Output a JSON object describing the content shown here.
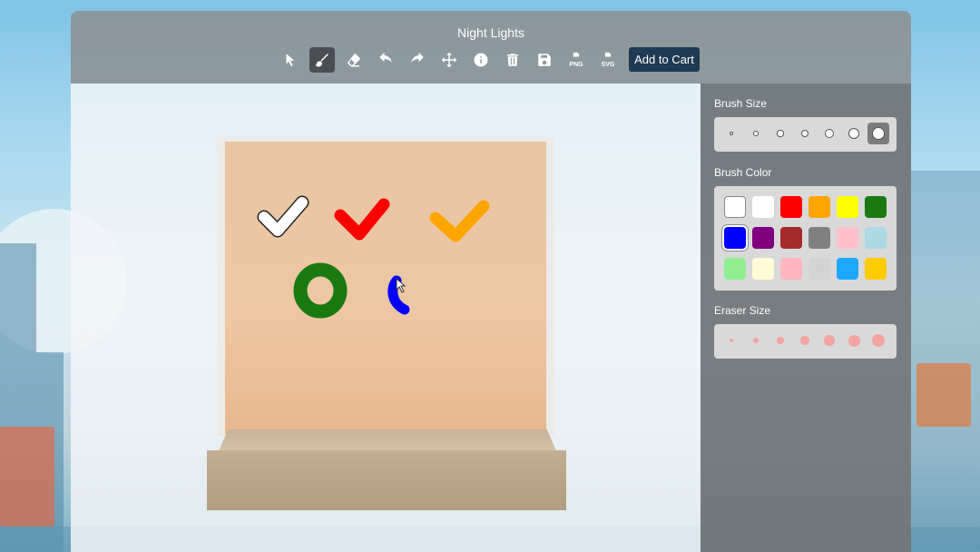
{
  "app": {
    "title": "Night Lights"
  },
  "toolbar": {
    "tools": [
      {
        "name": "select",
        "icon": "cursor-arrow-icon"
      },
      {
        "name": "brush",
        "icon": "paintbrush-icon",
        "active": true
      },
      {
        "name": "eraser",
        "icon": "eraser-icon"
      },
      {
        "name": "undo",
        "icon": "undo-arrow-icon"
      },
      {
        "name": "redo",
        "icon": "redo-arrow-icon"
      },
      {
        "name": "move",
        "icon": "move-arrows-icon"
      },
      {
        "name": "info",
        "icon": "info-circle-icon"
      },
      {
        "name": "delete",
        "icon": "trash-icon"
      },
      {
        "name": "save",
        "icon": "save-disk-icon"
      },
      {
        "name": "export-png",
        "icon": "png-file-icon",
        "label": "PNG"
      },
      {
        "name": "export-svg",
        "icon": "svg-file-icon",
        "label": "SVG"
      }
    ],
    "cart_label": "Add to Cart"
  },
  "panel": {
    "brush_size_title": "Brush Size",
    "brush_sizes_count": 7,
    "brush_size_selected_index": 6,
    "brush_color_title": "Brush Color",
    "colors": [
      "#ffffff",
      "#ffffff",
      "#ff0000",
      "#ffa500",
      "#ffff00",
      "#1a7a12",
      "#0000ff",
      "#800080",
      "#a52a2a",
      "#808080",
      "#ffc0cb",
      "#add8e6",
      "#90ee90",
      "#fffbd6",
      "#ffb6c1",
      "#d3d3d3",
      "#1ea7ff",
      "#ffcc00"
    ],
    "color_selected_index": 6,
    "eraser_size_title": "Eraser Size",
    "eraser_sizes_count": 7,
    "accent": "#1f3a52"
  }
}
